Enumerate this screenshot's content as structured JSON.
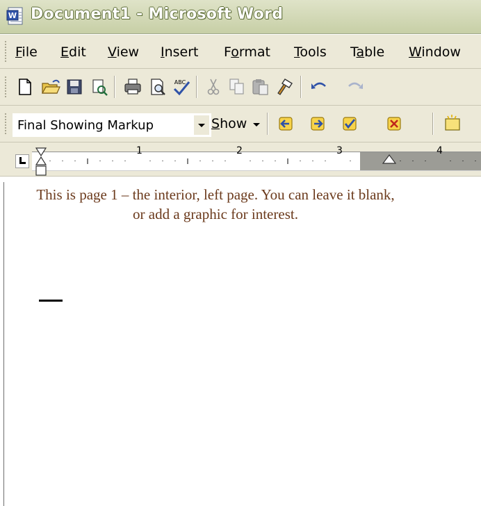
{
  "window": {
    "title": "Document1 - Microsoft Word",
    "app_icon": "word-document-icon"
  },
  "menu": {
    "items": [
      {
        "pre": "",
        "u": "F",
        "post": "ile"
      },
      {
        "pre": "",
        "u": "E",
        "post": "dit"
      },
      {
        "pre": "",
        "u": "V",
        "post": "iew"
      },
      {
        "pre": "",
        "u": "I",
        "post": "nsert"
      },
      {
        "pre": "F",
        "u": "o",
        "post": "rmat"
      },
      {
        "pre": "",
        "u": "T",
        "post": "ools"
      },
      {
        "pre": "T",
        "u": "a",
        "post": "ble"
      },
      {
        "pre": "",
        "u": "W",
        "post": "indow"
      }
    ]
  },
  "standard_toolbar": {
    "icons": [
      "new-document-icon",
      "open-folder-icon",
      "save-icon",
      "permission-icon",
      "print-icon",
      "print-preview-icon",
      "spelling-grammar-icon",
      "cut-icon",
      "copy-icon",
      "paste-icon",
      "format-painter-icon",
      "undo-icon",
      "redo-icon"
    ]
  },
  "reviewing_toolbar": {
    "display_value": "Final Showing Markup",
    "show_pre": "",
    "show_u": "S",
    "show_post": "how",
    "icons": [
      "previous-change-icon",
      "next-change-icon",
      "accept-change-icon",
      "reject-change-icon",
      "new-comment-icon"
    ]
  },
  "ruler": {
    "numbers": [
      "1",
      "2",
      "3",
      "4"
    ]
  },
  "document": {
    "text": "This is page 1 – the interior, left page.  You can leave it blank, or add a graphic for interest."
  },
  "colors": {
    "title_bar": "#c7cfa6",
    "toolbar_bg": "#ece9d8",
    "body_text": "#6b3a1c"
  }
}
